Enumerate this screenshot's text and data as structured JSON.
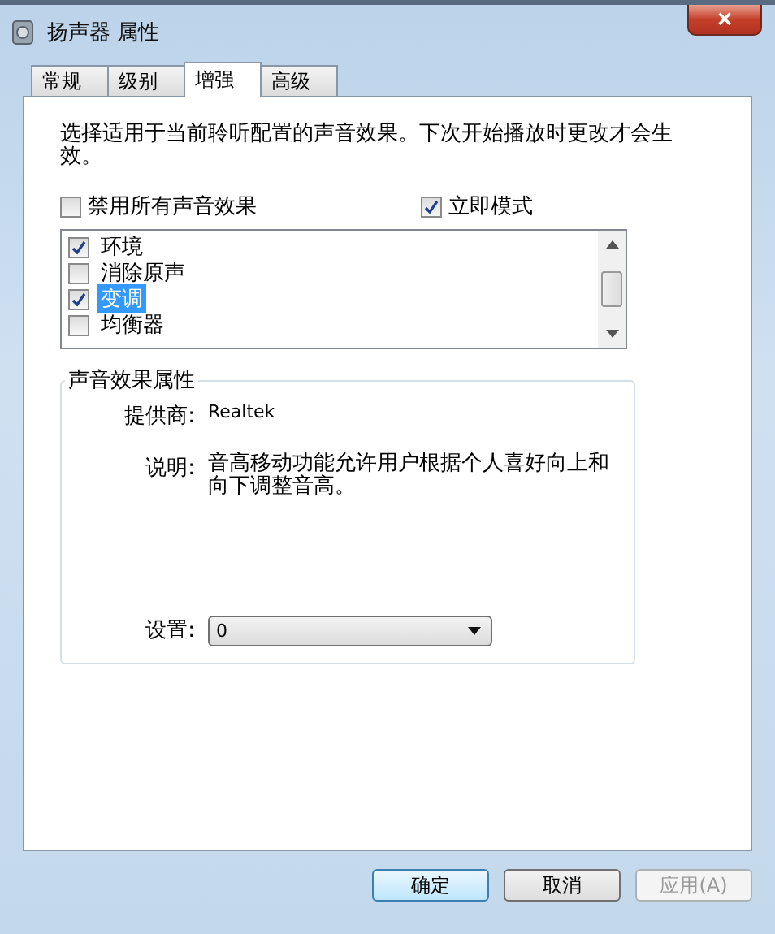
{
  "window": {
    "title": "扬声器 属性",
    "close": "✕"
  },
  "tabs": [
    {
      "label": "常规",
      "selected": false
    },
    {
      "label": "级别",
      "selected": false
    },
    {
      "label": "增强",
      "selected": true
    },
    {
      "label": "高级",
      "selected": false
    }
  ],
  "intro": "选择适用于当前聆听配置的声音效果。下次开始播放时更改才会生效。",
  "options": [
    {
      "label": "禁用所有声音效果",
      "checked": false
    },
    {
      "label": "立即模式",
      "checked": true
    }
  ],
  "effects": [
    {
      "label": "环境",
      "checked": true,
      "selected": false
    },
    {
      "label": "消除原声",
      "checked": false,
      "selected": false
    },
    {
      "label": "变调",
      "checked": true,
      "selected": true
    },
    {
      "label": "均衡器",
      "checked": false,
      "selected": false
    }
  ],
  "properties": {
    "title": "声音效果属性",
    "provider_label": "提供商:",
    "provider": "Realtek",
    "description_label": "说明:",
    "description": "音高移动功能允许用户根据个人喜好向上和向下调整音高。",
    "setting_label": "设置:",
    "setting": "0"
  },
  "buttons": [
    {
      "label": "确定",
      "disabled": false,
      "default": true
    },
    {
      "label": "取消",
      "disabled": false,
      "default": false
    },
    {
      "label": "应用(A)",
      "disabled": true,
      "default": false
    }
  ]
}
